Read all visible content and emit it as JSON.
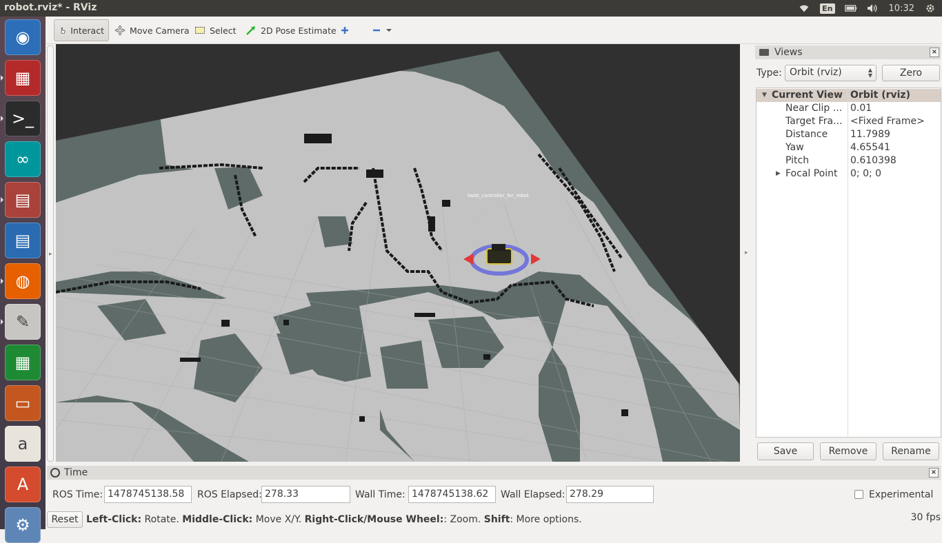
{
  "window": {
    "title": "robot.rviz* - RViz"
  },
  "system_tray": {
    "language": "En",
    "clock": "10:32"
  },
  "launcher": {
    "items": [
      {
        "name": "ubuntu-dash",
        "color": "#2c6fb8"
      },
      {
        "name": "workspaces",
        "color": "#b42a2a"
      },
      {
        "name": "terminal",
        "color": "#2b2b2b"
      },
      {
        "name": "arduino",
        "color": "#00979c"
      },
      {
        "name": "files",
        "color": "#a9423b"
      },
      {
        "name": "libreoffice-writer",
        "color": "#2a6bb2"
      },
      {
        "name": "firefox",
        "color": "#e66000"
      },
      {
        "name": "text-editor",
        "color": "#c8c6c2"
      },
      {
        "name": "libreoffice-calc",
        "color": "#1e8a34"
      },
      {
        "name": "libreoffice-impress",
        "color": "#c3571f"
      },
      {
        "name": "amazon",
        "color": "#e8e4dc"
      },
      {
        "name": "software-center",
        "color": "#d54b2d"
      },
      {
        "name": "system-settings",
        "color": "#5d86b6"
      }
    ]
  },
  "toolbar": {
    "tools": [
      {
        "id": "interact",
        "label": "Interact",
        "active": true
      },
      {
        "id": "move-camera",
        "label": "Move Camera"
      },
      {
        "id": "select",
        "label": "Select"
      },
      {
        "id": "pose-estimate",
        "label": "2D Pose Estimate"
      }
    ]
  },
  "viewport": {
    "robot_label": "twist_controller_for_robot"
  },
  "views_panel": {
    "title": "Views",
    "type_label": "Type:",
    "type_value": "Orbit (rviz)",
    "zero_label": "Zero",
    "current_view": {
      "key": "Current View",
      "value": "Orbit (rviz)"
    },
    "properties": [
      {
        "key": "Near Clip ...",
        "value": "0.01"
      },
      {
        "key": "Target Fra...",
        "value": "<Fixed Frame>"
      },
      {
        "key": "Distance",
        "value": "11.7989"
      },
      {
        "key": "Yaw",
        "value": "4.65541"
      },
      {
        "key": "Pitch",
        "value": "0.610398"
      },
      {
        "key": "Focal Point",
        "value": "0; 0; 0"
      }
    ],
    "buttons": {
      "save": "Save",
      "remove": "Remove",
      "rename": "Rename"
    }
  },
  "time_panel": {
    "title": "Time",
    "ros_time_label": "ROS Time:",
    "ros_time": "1478745138.58",
    "ros_elapsed_label": "ROS Elapsed:",
    "ros_elapsed": "278.33",
    "wall_time_label": "Wall Time:",
    "wall_time": "1478745138.62",
    "wall_elapsed_label": "Wall Elapsed:",
    "wall_elapsed": "278.29",
    "experimental_label": "Experimental",
    "experimental_checked": false
  },
  "status_bar": {
    "reset_label": "Reset",
    "hint": {
      "left_click": "Left-Click:",
      "left_action": " Rotate. ",
      "middle_click": "Middle-Click:",
      "middle_action": " Move X/Y. ",
      "right_click": "Right-Click/Mouse Wheel:",
      "right_action": ": Zoom. ",
      "shift": "Shift",
      "shift_action": ": More options."
    },
    "fps": "30 fps"
  },
  "colors": {
    "map_unknown": "#5e6b69",
    "map_free": "#c3c3c3",
    "map_obstacle": "#1a1a1a",
    "background": "#303030",
    "panel_header": "#dedcd8",
    "tree_header": "#d9cfc7"
  }
}
